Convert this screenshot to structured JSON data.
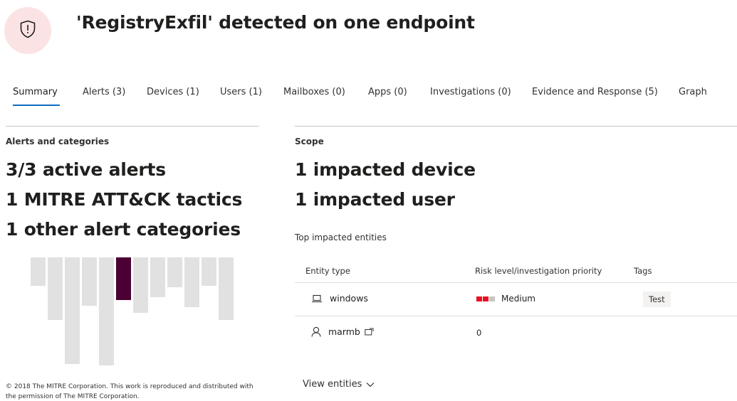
{
  "incident": {
    "title": "'RegistryExfil' detected on one endpoint",
    "icon": "shield-alert-icon",
    "badge_color": "#fbe3e4"
  },
  "tabs": [
    {
      "label": "Summary",
      "active": true
    },
    {
      "label": "Alerts (3)"
    },
    {
      "label": "Devices (1)"
    },
    {
      "label": "Users (1)"
    },
    {
      "label": "Mailboxes (0)"
    },
    {
      "label": "Apps (0)"
    },
    {
      "label": "Investigations (0)"
    },
    {
      "label": "Evidence and Response (5)"
    },
    {
      "label": "Graph"
    }
  ],
  "alerts_panel": {
    "label": "Alerts and categories",
    "active_alerts": "3/3 active alerts",
    "mitre_tactics": "1 MITRE ATT&CK tactics",
    "other_categories": "1 other alert categories",
    "matrix_highlight_color": "#4b0034",
    "matrix_columns": 12,
    "matrix_active_column": 6,
    "copyright": "© 2018 The MITRE Corporation. This work is reproduced and distributed with the permission of The MITRE Corporation."
  },
  "scope_panel": {
    "label": "Scope",
    "impacted_devices": "1 impacted device",
    "impacted_users": "1 impacted user",
    "top_entities_label": "Top impacted entities",
    "columns": {
      "entity_type": "Entity type",
      "risk": "Risk level/investigation priority",
      "tags": "Tags"
    },
    "rows": [
      {
        "icon": "laptop-icon",
        "name": "windows",
        "risk": "Medium",
        "tag": "Test"
      },
      {
        "icon": "user-icon",
        "name": "marmb",
        "extra_icon": "external-link-icon",
        "risk": "0",
        "tag": ""
      }
    ],
    "view_entities": "View entities",
    "risk_color": "#e81123"
  }
}
